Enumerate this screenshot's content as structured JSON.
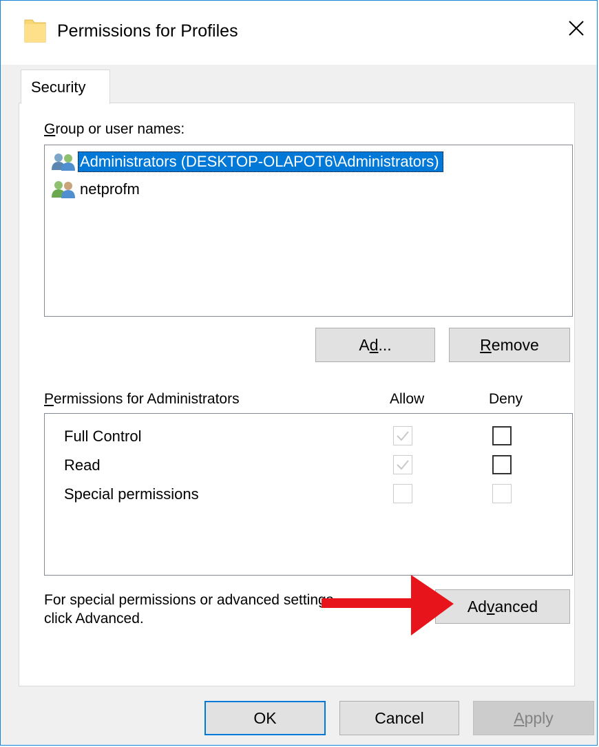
{
  "window": {
    "title": "Permissions for Profiles",
    "accent_color": "#1883d7"
  },
  "tabs": [
    {
      "label": "Security",
      "active": true
    }
  ],
  "group_section": {
    "label": "Group or user names:",
    "label_mnemonic": "G",
    "label_rest": "roup or user names:",
    "users": [
      {
        "name": "Administrators (DESKTOP-OLAPOT6\\Administrators)",
        "icon": "users-group-icon",
        "selected": true
      },
      {
        "name": "netprofm",
        "icon": "users-group-icon",
        "selected": false
      }
    ],
    "add_button": {
      "label": "Add...",
      "mnemonic_before": "A",
      "mnemonic": "d",
      "mnemonic_after": "d..."
    },
    "remove_button": {
      "label": "Remove",
      "mnemonic": "R",
      "mnemonic_after": "emove"
    }
  },
  "permissions_section": {
    "label": "Permissions for Administrators",
    "label_mnemonic": "P",
    "label_rest": "ermissions for Administrators",
    "allow_header": "Allow",
    "deny_header": "Deny",
    "rows": [
      {
        "name": "Full Control",
        "allow": true,
        "deny": false,
        "allow_enabled": false,
        "deny_enabled": true
      },
      {
        "name": "Read",
        "allow": true,
        "deny": false,
        "allow_enabled": false,
        "deny_enabled": true
      },
      {
        "name": "Special permissions",
        "allow": false,
        "deny": false,
        "allow_enabled": false,
        "deny_enabled": false
      }
    ]
  },
  "advanced_section": {
    "hint_line1": "For special permissions or advanced settings,",
    "hint_line2": "click Advanced.",
    "button": {
      "label": "Advanced",
      "mnemonic_before": "Ad",
      "mnemonic": "v",
      "mnemonic_after": "anced"
    }
  },
  "footer": {
    "ok_label": "OK",
    "cancel_label": "Cancel",
    "apply_label": "Apply",
    "apply_mnemonic": "A",
    "apply_rest": "pply"
  },
  "colors": {
    "selection": "#0078d7",
    "annotation_arrow": "#e8141b"
  }
}
